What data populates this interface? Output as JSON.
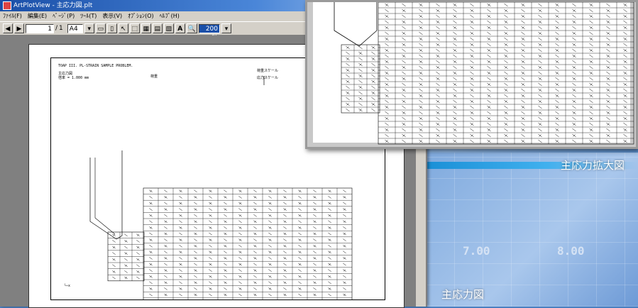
{
  "app": {
    "title": "ArtPlotView - 主応力図.plt",
    "menu": [
      "ﾌｧｲﾙ(F)",
      "編集(E)",
      "ﾍﾟｰｼﾞ(P)",
      "ﾂｰﾙ(T)",
      "表示(V)",
      "ｵﾌﾟｼｮﾝ(O)",
      "ﾍﾙﾌﾟ(H)"
    ],
    "toolbar": {
      "page_current": "1",
      "page_separator": "/",
      "page_total": "1",
      "paper_size": "A4",
      "zoom": "200 %"
    }
  },
  "document": {
    "heading": "TOAP III. PL-STRAIN SAMPLE PROBLEM.",
    "line2_left": "主応力図",
    "line2_mid": "荷重",
    "line3_left": "倍率 =   1.000 mm",
    "legend_a": "荷重スケール",
    "legend_b": "応力スケール",
    "axis_mark": "└─x"
  },
  "overlay": {
    "zoom_caption": "主応力拡大図",
    "main_caption": "主応力図",
    "grid_numbers": [
      "7.00",
      "8.00"
    ]
  },
  "colors": {
    "title_bar": "#1a4fa8",
    "background_blue": "#4d86cc",
    "accent_bar": "#1a8fd6"
  }
}
